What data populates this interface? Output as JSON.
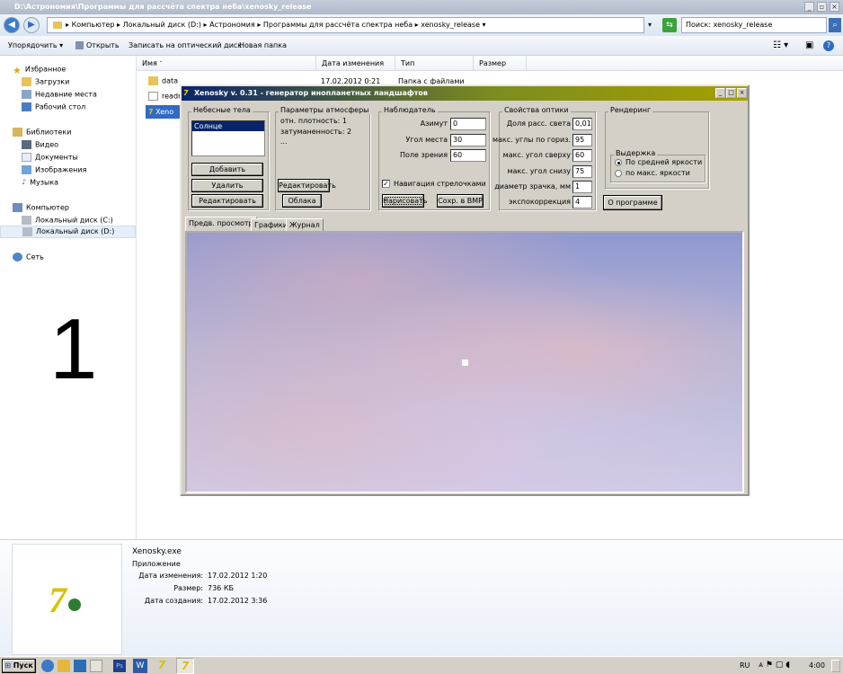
{
  "window": {
    "title": "D:\\Астрономия\\Программы для рассчёта спектра неба\\xenosky_release"
  },
  "address": {
    "segments": [
      "Компьютер",
      "Локальный диск (D:)",
      "Астрономия",
      "Программы для рассчёта спектра неба",
      "xenosky_release"
    ],
    "search_value": "Поиск: xenosky_release"
  },
  "toolbar": {
    "organize": "Упорядочить",
    "open": "Открыть",
    "burn": "Записать на оптический диск",
    "new_folder": "Новая папка"
  },
  "nav": {
    "favorites": "Избранное",
    "downloads": "Загрузки",
    "recent": "Недавние места",
    "desktop": "Рабочий стол",
    "libraries": "Библиотеки",
    "video": "Видео",
    "documents": "Документы",
    "images": "Изображения",
    "music": "Музыка",
    "computer": "Компьютер",
    "disk_c": "Локальный диск (C:)",
    "disk_d": "Локальный диск (D:)",
    "network": "Сеть"
  },
  "overlay_number": "1",
  "columns": {
    "name": "Имя",
    "date": "Дата изменения",
    "type": "Тип",
    "size": "Размер"
  },
  "files": [
    {
      "name": "data",
      "date": "17.02.2012 0:21",
      "type": "Папка с файлами"
    },
    {
      "name": "readm",
      "date": "",
      "type": ""
    },
    {
      "name": "Xeno",
      "date": "",
      "type": ""
    }
  ],
  "app": {
    "title": "Xenosky v. 0.31 - генератор инопланетных ландшафтов",
    "bodies": {
      "label": "Небесные тела",
      "items": [
        "Солнце"
      ],
      "add": "Добавить",
      "delete": "Удалить",
      "edit": "Редактировать"
    },
    "atmosphere": {
      "label": "Параметры атмосферы",
      "density": "отн. плотность: 1",
      "extinction": "затуманенность: 2",
      "more": "...",
      "edit": "Редактировать",
      "clouds": "Облака"
    },
    "observer": {
      "label": "Наблюдатель",
      "azimuth_label": "Азимут",
      "azimuth": "0",
      "altitude_label": "Угол места",
      "altitude": "30",
      "fov_label": "Поле зрения",
      "fov": "60",
      "arrows": "Навигация стрелочками",
      "draw": "Нарисовать",
      "save": "Сохр. в BMP"
    },
    "optics": {
      "label": "Свойства оптики",
      "fields": [
        {
          "label": "Доля расс. света",
          "value": "0,01"
        },
        {
          "label": "макс. углы по гориз.",
          "value": "95"
        },
        {
          "label": "макс. угол сверху",
          "value": "60"
        },
        {
          "label": "макс. угол снизу",
          "value": "75"
        },
        {
          "label": "диаметр зрачка, мм",
          "value": "1"
        },
        {
          "label": "экспокоррекция",
          "value": "4"
        }
      ]
    },
    "render": {
      "label": "Рендеринг",
      "exposure": "Выдержка",
      "opt_avg": "По средней яркости",
      "opt_max": "по макс. яркости",
      "about": "О программе"
    },
    "tabs": [
      "Предв. просмотр",
      "Графики",
      "Журнал"
    ]
  },
  "details": {
    "filename": "Xenosky.exe",
    "kind": "Приложение",
    "modified_label": "Дата изменения:",
    "modified": "17.02.2012 1:20",
    "size_label": "Размер:",
    "size": "736 КБ",
    "created_label": "Дата создания:",
    "created": "17.02.2012 3:36"
  },
  "taskbar": {
    "start": "Пуск",
    "lang": "RU",
    "clock": "4:00"
  }
}
